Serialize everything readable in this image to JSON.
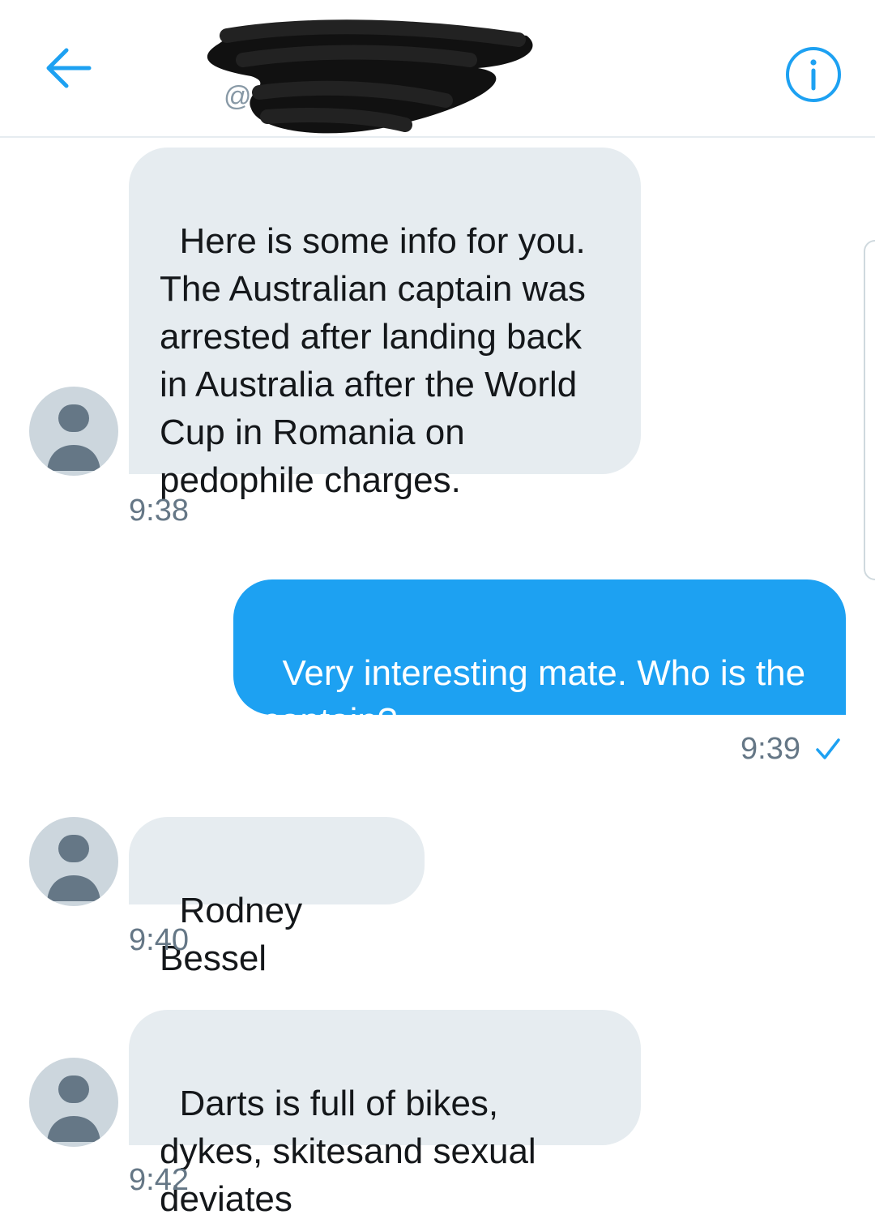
{
  "header": {
    "handle_prefix": "@",
    "back_icon": "arrow-left-icon",
    "info_icon": "info-icon",
    "accent_color": "#1da1f2"
  },
  "messages": [
    {
      "direction": "received",
      "text": "Here is some info for you. The Australian captain was arrested after landing back in Australia after the World Cup in Romania on pedophile charges.",
      "time": "9:38"
    },
    {
      "direction": "sent",
      "text": "Very interesting mate. Who is the captain?",
      "time": "9:39",
      "status_icon": "checkmark-icon"
    },
    {
      "direction": "received",
      "text": "Rodney Bessel",
      "time": "9:40"
    },
    {
      "direction": "received",
      "text": "Darts is full of bikes, dykes, skitesand sexual deviates",
      "time": "9:42"
    }
  ],
  "colors": {
    "received_bubble": "#e6ecf0",
    "sent_bubble": "#1da1f2",
    "timestamp": "#657786"
  }
}
